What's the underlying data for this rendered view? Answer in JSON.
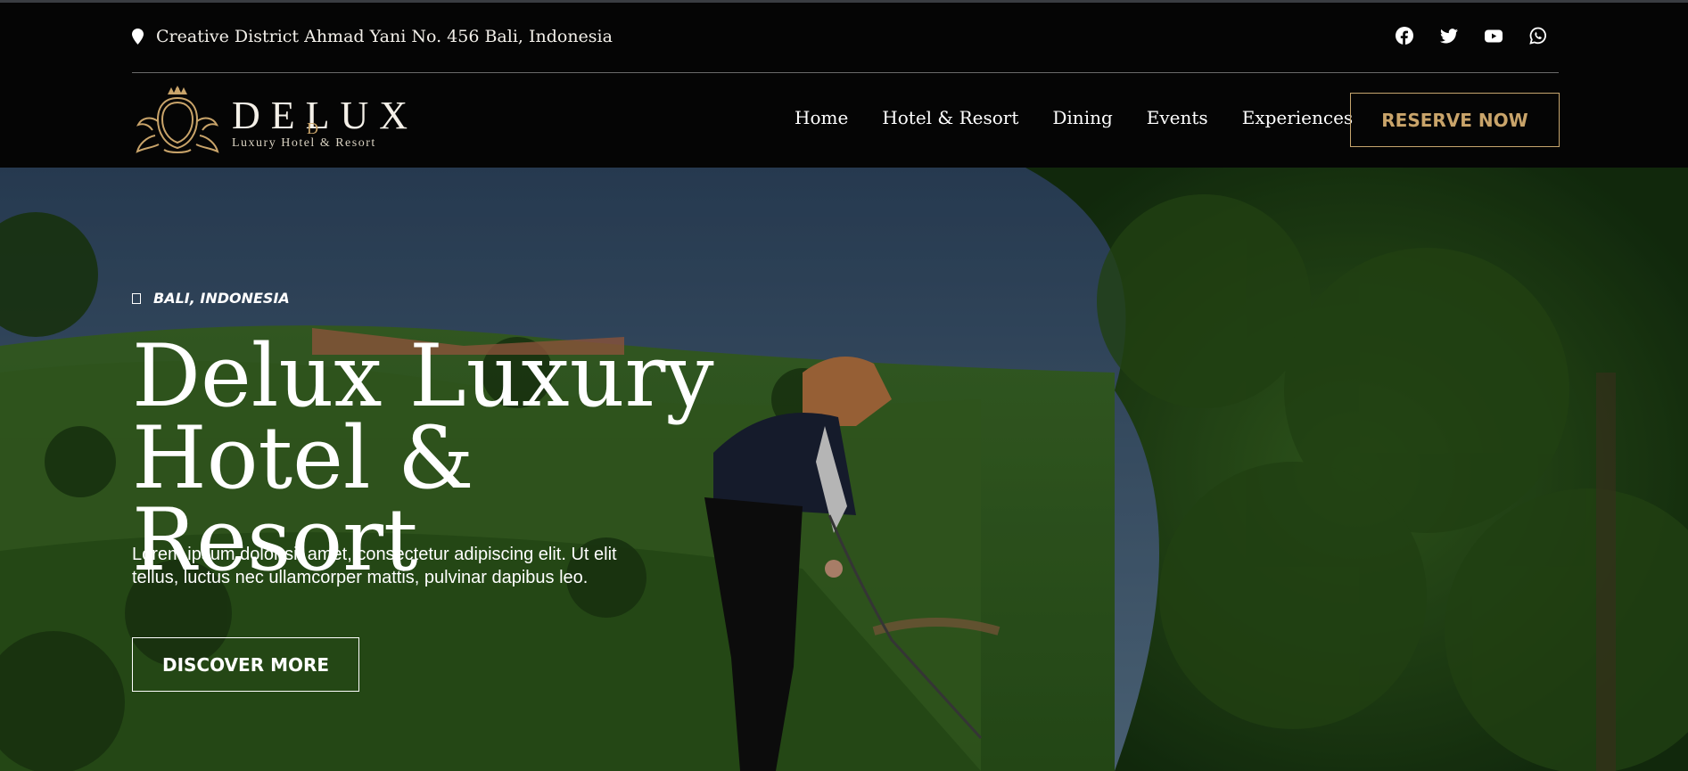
{
  "topbar": {
    "address": "Creative District Ahmad Yani No. 456 Bali, Indonesia",
    "address_icon": "map-pin-icon",
    "socials": [
      "facebook-icon",
      "twitter-icon",
      "youtube-icon",
      "whatsapp-icon"
    ]
  },
  "brand": {
    "name": "DELUX",
    "tagline": "Luxury Hotel & Resort",
    "emblem_letter": "D"
  },
  "nav": {
    "items": [
      {
        "label": "Home"
      },
      {
        "label": "Hotel & Resort"
      },
      {
        "label": "Dining"
      },
      {
        "label": "Events"
      },
      {
        "label": "Experiences"
      }
    ],
    "cta_label": "RESERVE NOW"
  },
  "hero": {
    "location": "BALI, INDONESIA",
    "title_line1": "Delux Luxury",
    "title_line2": "Hotel & Resort",
    "description_line1": "Lorem ipsum dolor sit amet, consectetur adipiscing elit. Ut elit",
    "description_line2": "tellus, luctus nec ullamcorper mattis, pulvinar dapibus leo.",
    "cta_label": "DISCOVER MORE"
  },
  "colors": {
    "background": "#050505",
    "accent_gold": "#c9a46a",
    "text_light": "#ffffff"
  }
}
